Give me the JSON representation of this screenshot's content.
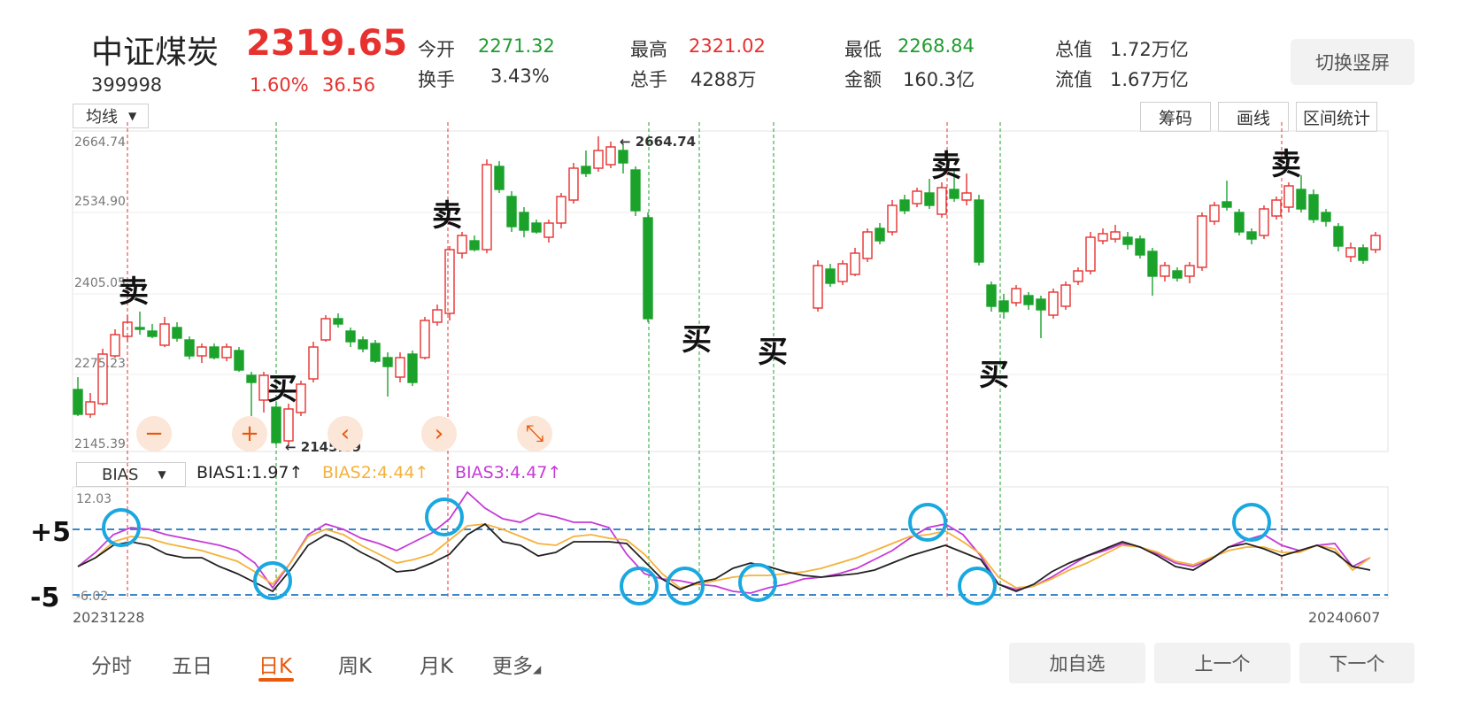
{
  "header": {
    "name": "中证煤炭",
    "code": "399998",
    "price": "2319.65",
    "change_pct": "1.60%",
    "change_abs": "36.56",
    "stats": [
      {
        "label": "今开",
        "value": "2271.32",
        "color": "green"
      },
      {
        "label": "最高",
        "value": "2321.02",
        "color": "red"
      },
      {
        "label": "最低",
        "value": "2268.84",
        "color": "green"
      },
      {
        "label": "总值",
        "value": "1.72万亿",
        "color": "plain"
      },
      {
        "label": "换手",
        "value": "3.43%",
        "color": "plain"
      },
      {
        "label": "总手",
        "value": "4288万",
        "color": "plain"
      },
      {
        "label": "金额",
        "value": "160.3亿",
        "color": "plain"
      },
      {
        "label": "流值",
        "value": "1.67万亿",
        "color": "plain"
      }
    ],
    "rotate_label": "切换竖屏"
  },
  "toolbar": {
    "avg_select": "均线",
    "chips": "筹码",
    "draw": "画线",
    "range_stats": "区间统计"
  },
  "kline": {
    "y_labels": [
      "2664.74",
      "2534.90",
      "2405.05",
      "2275.23",
      "2145.39"
    ],
    "high_marker": "2664.74",
    "low_marker": "2145.39",
    "sell_label": "卖",
    "buy_label": "买"
  },
  "controls": {
    "minus": "−",
    "plus": "+",
    "left": "‹",
    "right": "›",
    "shrink": "⤡"
  },
  "bias": {
    "select": "BIAS",
    "bias1": "BIAS1:1.97↑",
    "bias2": "BIAS2:4.44↑",
    "bias3": "BIAS3:4.47↑",
    "y_top": "12.03",
    "y_bottom": "-6.02",
    "plus5": "+5",
    "minus5": "-5",
    "start_date": "20231228",
    "end_date": "20240607"
  },
  "tabs": [
    "分时",
    "五日",
    "日K",
    "周K",
    "月K",
    "更多"
  ],
  "active_tab": "日K",
  "nav": {
    "add": "加自选",
    "prev": "上一个",
    "next": "下一个"
  },
  "colors": {
    "up": "#e6312f",
    "down": "#1aa22b",
    "bias1": "#222222",
    "bias2": "#f4b23a",
    "bias3": "#c63ad8",
    "ref_line": "#3a86c8",
    "circle": "#1aa8e0",
    "accent": "#e8590c"
  }
}
